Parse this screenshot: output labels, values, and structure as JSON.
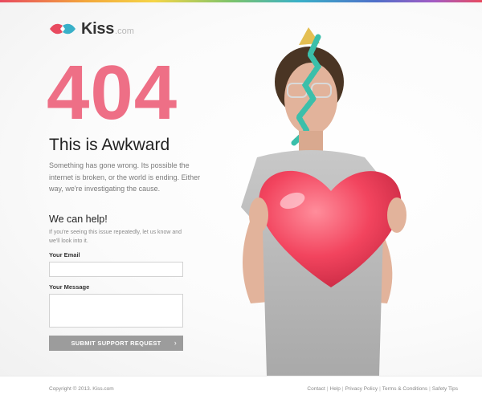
{
  "brand": {
    "name": "Kiss",
    "suffix": ".com",
    "accent_color": "#ee6f86",
    "logo_colors": [
      "#e84a5f",
      "#39b0c8"
    ]
  },
  "error": {
    "code": "404",
    "title": "This is Awkward",
    "description": "Something has gone wrong. Its possible the internet is broken, or the world is ending. Either way, we're investigating the cause."
  },
  "help": {
    "title": "We can help!",
    "description": "If you're seeing this issue repeatedly, let us know and we'll look into it."
  },
  "form": {
    "email_label": "Your Email",
    "email_value": "",
    "message_label": "Your Message",
    "message_value": "",
    "submit_label": "SUBMIT SUPPORT REQUEST",
    "submit_icon": "chevron-right-icon",
    "button_color": "#9c9c9c"
  },
  "footer": {
    "copyright": "Copyright © 2013. Kiss.com",
    "links": [
      "Contact",
      "Help",
      "Privacy Policy",
      "Terms & Conditions",
      "Safety Tips"
    ]
  }
}
